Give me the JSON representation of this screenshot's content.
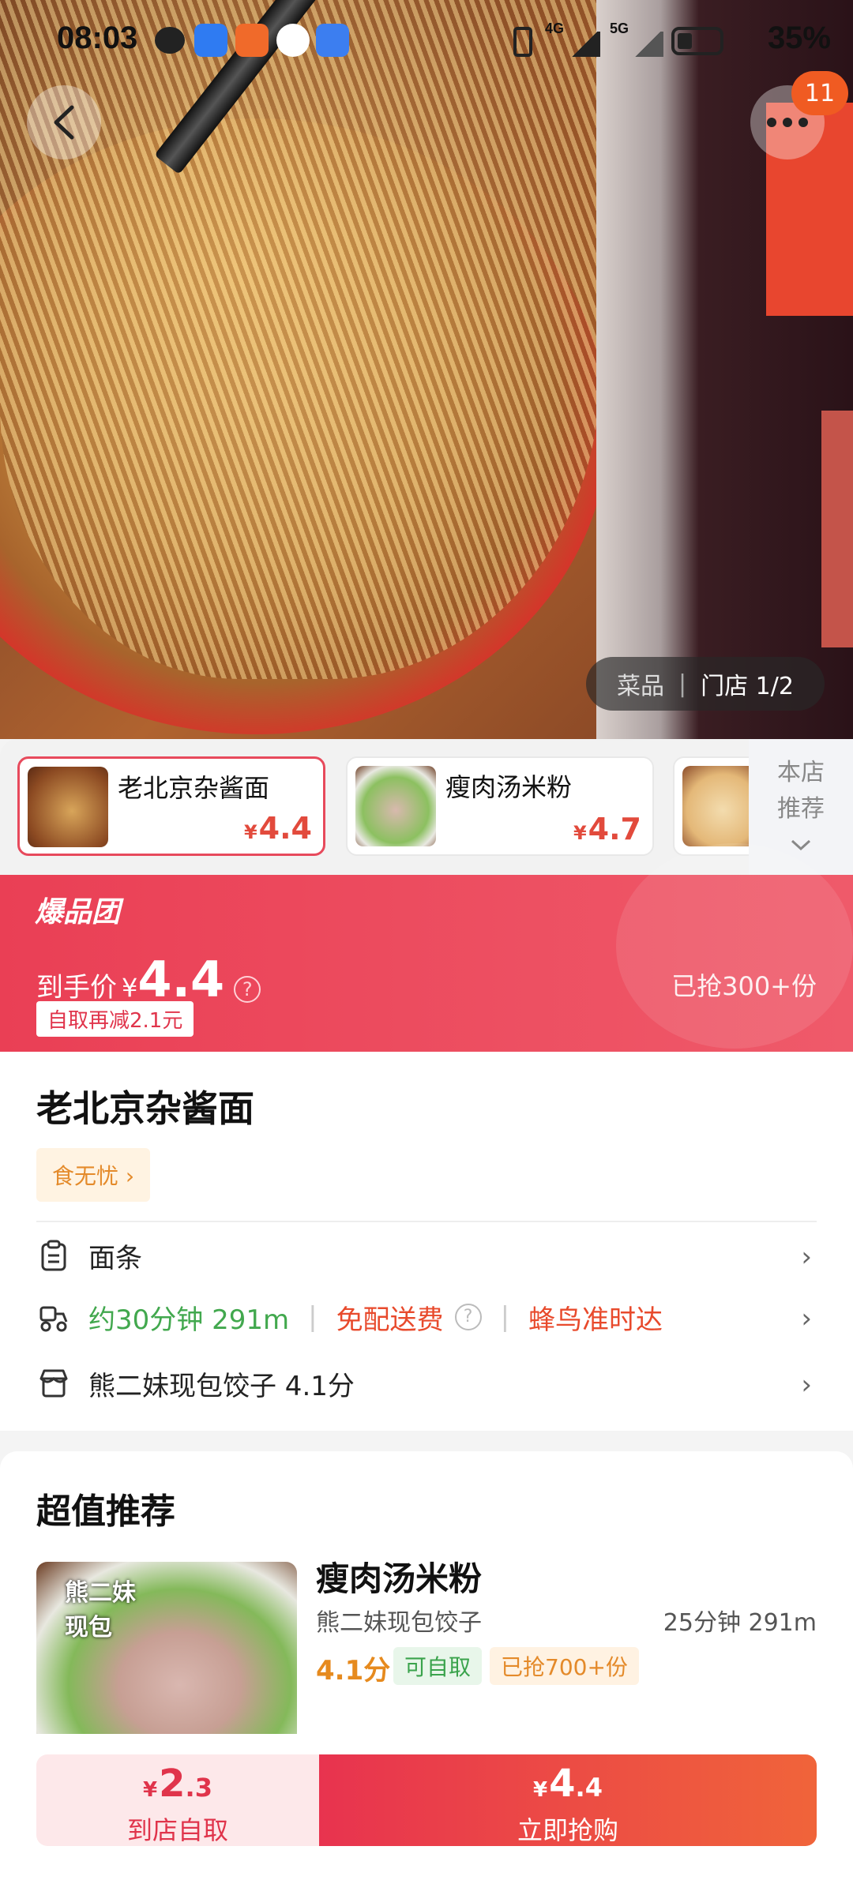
{
  "status": {
    "time": "08:03",
    "battery": "35%",
    "net1": "4G",
    "net2": "5G"
  },
  "hero": {
    "badge_count": "11",
    "tab_dish": "菜品",
    "tab_sep": "|",
    "tab_store": "门店 1/2"
  },
  "dishes": [
    {
      "name": "老北京杂酱面",
      "price": "4.4",
      "currency": "¥"
    },
    {
      "name": "瘦肉汤米粉",
      "price": "4.7",
      "currency": "¥"
    }
  ],
  "store_rec": {
    "line1": "本店",
    "line2": "推荐"
  },
  "promo": {
    "logo": "爆品团",
    "label": "到手价",
    "currency": "¥",
    "price": "4.4",
    "help": "?",
    "sold": "已抢300+份",
    "coupon": "自取再减2.1元"
  },
  "item": {
    "title": "老北京杂酱面",
    "tag": "食无忧 ›",
    "category": "面条",
    "delivery_time": "约30分钟 291m",
    "free_delivery": "免配送费",
    "help": "?",
    "ontime": "蜂鸟准时达",
    "store": "熊二妹现包饺子 4.1分",
    "chevron": "›"
  },
  "recommend": {
    "heading": "超值推荐",
    "brand": "熊二妹\n现包",
    "name": "瘦肉汤米粉",
    "store": "熊二妹现包饺子",
    "distance": "25分钟  291m",
    "score": "4.1分",
    "chip_pickup": "可自取",
    "chip_sold": "已抢700+份"
  },
  "bottom": {
    "pickup_currency": "¥",
    "pickup_int": "2",
    "pickup_dec": ".3",
    "pickup_label": "到店自取",
    "buy_currency": "¥",
    "buy_int": "4",
    "buy_dec": ".4",
    "buy_label": "立即抢购"
  }
}
